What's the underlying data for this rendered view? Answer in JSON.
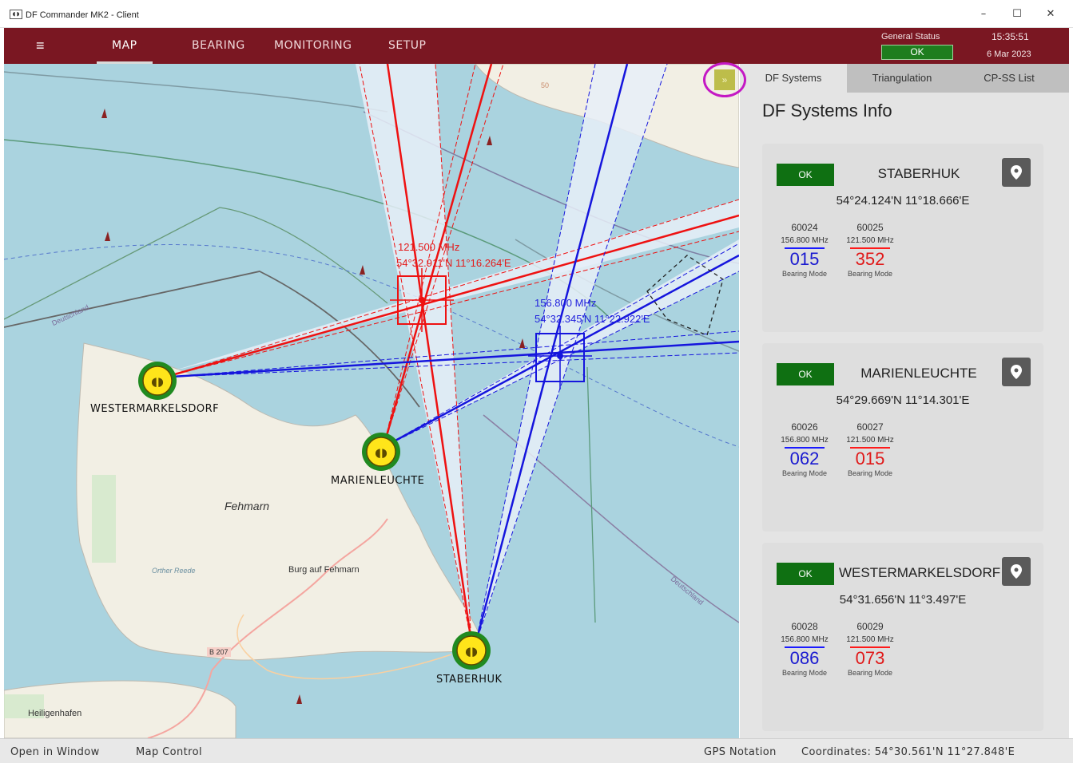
{
  "window": {
    "title": "DF Commander MK2 - Client",
    "app_icon": "df-logo-icon",
    "controls": [
      "minimize-icon",
      "maximize-icon",
      "close-icon"
    ]
  },
  "navbar": {
    "tabs": [
      {
        "label": "MAP",
        "active": true
      },
      {
        "label": "BEARING",
        "active": false
      },
      {
        "label": "MONITORING",
        "active": false
      },
      {
        "label": "SETUP",
        "active": false
      }
    ],
    "general_status_label": "General Status",
    "general_status_value": "OK",
    "time": "15:35:51",
    "date": "6 Mar 2023",
    "accent_color": "#7a1722"
  },
  "map": {
    "island_name": "Fehmarn",
    "places": {
      "burg": "Burg auf Fehmarn",
      "heiligenhafen": "Heiligenhafen",
      "orther_reede": "Orther Reede",
      "deutschland_west": "Deutschland",
      "deutschland_east": "Deutschland",
      "road": "B 207",
      "contour_50": "50"
    },
    "sites": [
      {
        "name": "WESTERMARKELSDORF"
      },
      {
        "name": "MARIENLEUCHTE"
      },
      {
        "name": "STABERHUK"
      }
    ],
    "fixes": [
      {
        "freq": "121.500 MHz",
        "coords": "54°32.911'N 11°16.264'E",
        "color": "#e41a1a"
      },
      {
        "freq": "156.800 MHz",
        "coords": "54°32.345'N 11°22.922'E",
        "color": "#2222dd"
      }
    ],
    "expand_button": "»",
    "collapse_button": "»"
  },
  "panel": {
    "tabs": [
      {
        "label": "DF Systems",
        "active": true
      },
      {
        "label": "Triangulation",
        "active": false
      },
      {
        "label": "CP-SS List",
        "active": false
      }
    ],
    "title": "DF Systems Info",
    "systems": [
      {
        "status": "OK",
        "name": "STABERHUK",
        "coords": "54°24.124'N 11°18.666'E",
        "channels": [
          {
            "id": "60024",
            "freq": "156.800 MHz",
            "bearing": "015",
            "mode": "Bearing Mode",
            "color": "blue"
          },
          {
            "id": "60025",
            "freq": "121.500 MHz",
            "bearing": "352",
            "mode": "Bearing Mode",
            "color": "red"
          }
        ]
      },
      {
        "status": "OK",
        "name": "MARIENLEUCHTE",
        "coords": "54°29.669'N 11°14.301'E",
        "channels": [
          {
            "id": "60026",
            "freq": "156.800 MHz",
            "bearing": "062",
            "mode": "Bearing Mode",
            "color": "blue"
          },
          {
            "id": "60027",
            "freq": "121.500 MHz",
            "bearing": "015",
            "mode": "Bearing Mode",
            "color": "red"
          }
        ]
      },
      {
        "status": "OK",
        "name": "WESTERMARKELSDORF",
        "coords": "54°31.656'N 11°3.497'E",
        "channels": [
          {
            "id": "60028",
            "freq": "156.800 MHz",
            "bearing": "086",
            "mode": "Bearing Mode",
            "color": "blue"
          },
          {
            "id": "60029",
            "freq": "121.500 MHz",
            "bearing": "073",
            "mode": "Bearing Mode",
            "color": "red"
          }
        ]
      }
    ]
  },
  "statusbar": {
    "open_in_window": "Open in Window",
    "map_control": "Map Control",
    "gps_notation": "GPS Notation",
    "coordinates": "Coordinates: 54°30.561'N 11°27.848'E"
  }
}
